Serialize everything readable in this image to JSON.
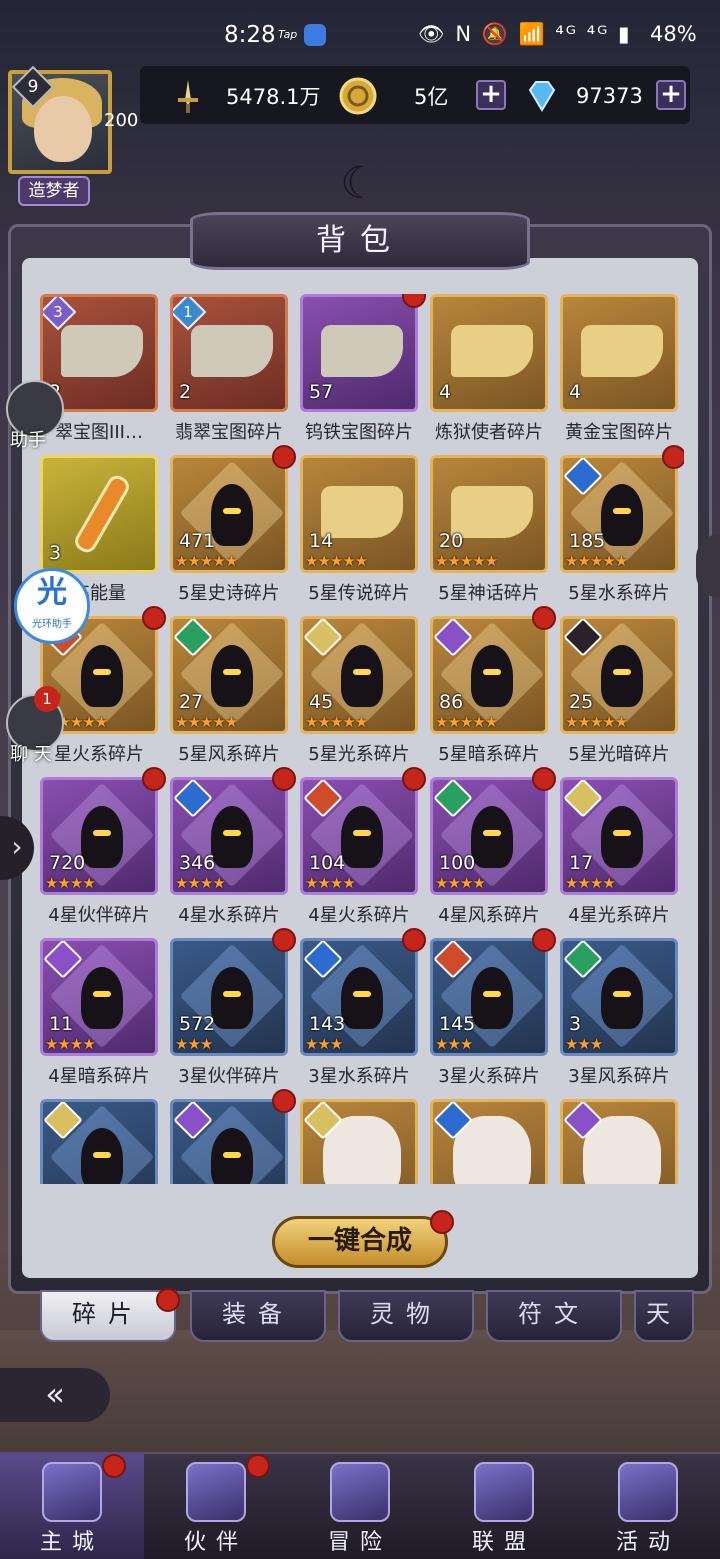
{
  "status_bar": {
    "time": "8:28",
    "tap": "Tap",
    "icons": "👁 N 🔕 📶 ⁴ᴳ ⁴ᴳ ▮",
    "battery": "48%"
  },
  "player": {
    "level": "9",
    "level_progress": "200",
    "rank": "造梦者"
  },
  "currencies": {
    "power": "5478.1万",
    "gold": "5亿",
    "gems": "97373"
  },
  "panel": {
    "title": "背包"
  },
  "items": [
    {
      "label": "翡翠宝图碎片III",
      "display_label": "翠宝图III…",
      "count": "2",
      "tile": "red",
      "art": "map",
      "badge": "3",
      "dot": false
    },
    {
      "label": "翡翠宝图碎片",
      "count": "2",
      "tile": "red",
      "art": "map",
      "badge": "1",
      "dot": false
    },
    {
      "label": "钨铁宝图碎片",
      "count": "57",
      "tile": "purple",
      "art": "map",
      "dot": true
    },
    {
      "label": "炼狱使者碎片",
      "count": "4",
      "tile": "gold",
      "art": "map",
      "dot": false
    },
    {
      "label": "黄金宝图碎片",
      "count": "4",
      "tile": "gold",
      "art": "map",
      "dot": false
    },
    {
      "label": "卒能量",
      "count": "3",
      "tile": "yellow",
      "art": "vial",
      "dot": false
    },
    {
      "label": "5星史诗碎片",
      "count": "471",
      "tile": "gold",
      "art": "hood",
      "stars": 5,
      "dot": true
    },
    {
      "label": "5星传说碎片",
      "count": "14",
      "tile": "gold",
      "art": "map",
      "stars": 5,
      "dot": false
    },
    {
      "label": "5星神话碎片",
      "count": "20",
      "tile": "gold",
      "art": "map",
      "stars": 5,
      "dot": false
    },
    {
      "label": "5星水系碎片",
      "count": "185",
      "tile": "gold",
      "art": "hood",
      "elem": "water",
      "stars": 5,
      "dot": true
    },
    {
      "label": "星火系碎片",
      "count": "7",
      "tile": "gold",
      "art": "hood",
      "elem": "fire",
      "stars": 5,
      "dot": true
    },
    {
      "label": "5星风系碎片",
      "count": "27",
      "tile": "gold",
      "art": "hood",
      "elem": "wind",
      "stars": 5,
      "dot": false
    },
    {
      "label": "5星光系碎片",
      "count": "45",
      "tile": "gold",
      "art": "hood",
      "elem": "light",
      "stars": 5,
      "dot": false
    },
    {
      "label": "5星暗系碎片",
      "count": "86",
      "tile": "gold",
      "art": "hood",
      "elem": "dark",
      "stars": 5,
      "dot": true
    },
    {
      "label": "5星光暗碎片",
      "count": "25",
      "tile": "gold",
      "art": "hood",
      "elem": "lightdark",
      "stars": 5,
      "dot": false
    },
    {
      "label": "4星伙伴碎片",
      "count": "720",
      "tile": "purple",
      "art": "hood",
      "stars": 4,
      "dot": true
    },
    {
      "label": "4星水系碎片",
      "count": "346",
      "tile": "purple",
      "art": "hood",
      "elem": "water",
      "stars": 4,
      "dot": true
    },
    {
      "label": "4星火系碎片",
      "count": "104",
      "tile": "purple",
      "art": "hood",
      "elem": "fire",
      "stars": 4,
      "dot": true
    },
    {
      "label": "4星风系碎片",
      "count": "100",
      "tile": "purple",
      "art": "hood",
      "elem": "wind",
      "stars": 4,
      "dot": true
    },
    {
      "label": "4星光系碎片",
      "count": "17",
      "tile": "purple",
      "art": "hood",
      "elem": "light",
      "stars": 4,
      "dot": false
    },
    {
      "label": "4星暗系碎片",
      "count": "11",
      "tile": "purple",
      "art": "hood",
      "elem": "dark",
      "stars": 4,
      "dot": false
    },
    {
      "label": "3星伙伴碎片",
      "count": "572",
      "tile": "blue",
      "art": "hood",
      "stars": 3,
      "dot": true
    },
    {
      "label": "3星水系碎片",
      "count": "143",
      "tile": "blue",
      "art": "hood",
      "elem": "water",
      "stars": 3,
      "dot": true
    },
    {
      "label": "3星火系碎片",
      "count": "145",
      "tile": "blue",
      "art": "hood",
      "elem": "fire",
      "stars": 3,
      "dot": true
    },
    {
      "label": "3星风系碎片",
      "count": "3",
      "tile": "blue",
      "art": "hood",
      "elem": "wind",
      "stars": 3,
      "dot": false
    },
    {
      "label": "",
      "count": "",
      "tile": "blue",
      "art": "hood",
      "elem": "light",
      "dot": false
    },
    {
      "label": "",
      "count": "",
      "tile": "blue",
      "art": "hood",
      "elem": "dark",
      "dot": true
    },
    {
      "label": "",
      "count": "",
      "tile": "gold",
      "art": "portrait",
      "elem": "light",
      "dot": false
    },
    {
      "label": "",
      "count": "",
      "tile": "gold",
      "art": "portrait",
      "elem": "water",
      "dot": false
    },
    {
      "label": "",
      "count": "",
      "tile": "gold",
      "art": "portrait",
      "elem": "dark",
      "dot": false
    }
  ],
  "merge_button": "一键合成",
  "tabs": [
    "碎片",
    "装备",
    "灵物",
    "符文",
    "天"
  ],
  "side": {
    "helper": "助手",
    "guang_glyph": "光",
    "guang_label": "光环助手",
    "chat": "聊天",
    "chat_badge": "1"
  },
  "nav": [
    "主城",
    "伙伴",
    "冒险",
    "联盟",
    "活动"
  ],
  "colors": {
    "notification": "#c6251c",
    "merge_gold": "#f2d27a",
    "panel_bg": "#cdd0d8"
  }
}
